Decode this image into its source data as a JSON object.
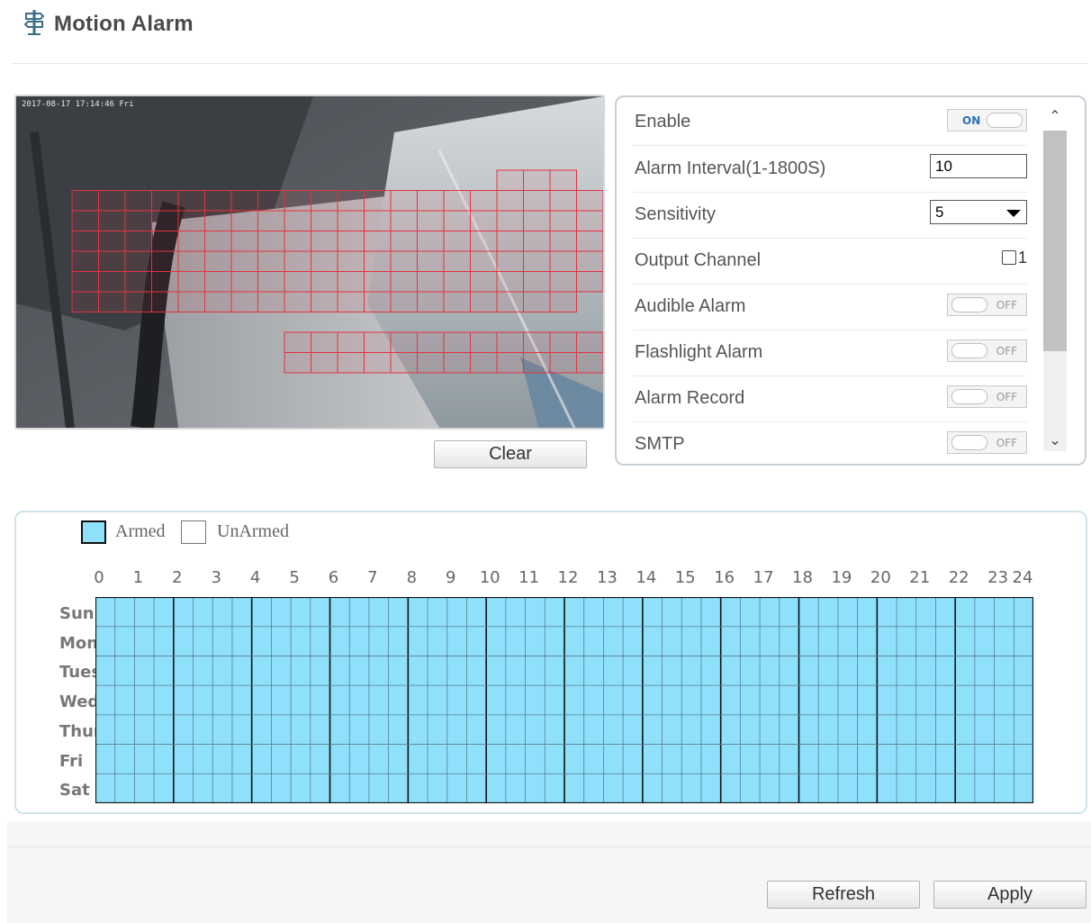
{
  "header": {
    "title": "Motion Alarm",
    "icon": "signpost-icon"
  },
  "video": {
    "timestamp": "2017-08-17 17:14:46 Fri"
  },
  "clear_label": "Clear",
  "settings": {
    "enable": {
      "label": "Enable",
      "state": "ON"
    },
    "alarm_interval": {
      "label": "Alarm Interval(1-1800S)",
      "value": "10"
    },
    "sensitivity": {
      "label": "Sensitivity",
      "value": "5"
    },
    "output_channel": {
      "label": "Output Channel",
      "option": "1",
      "checked": false
    },
    "audible_alarm": {
      "label": "Audible Alarm",
      "state": "OFF"
    },
    "flashlight_alarm": {
      "label": "Flashlight Alarm",
      "state": "OFF"
    },
    "alarm_record": {
      "label": "Alarm Record",
      "state": "OFF"
    },
    "smtp": {
      "label": "SMTP",
      "state": "OFF"
    }
  },
  "schedule": {
    "legend_armed": "Armed",
    "legend_unarmed": "UnArmed",
    "hours": [
      "0",
      "1",
      "2",
      "3",
      "4",
      "5",
      "6",
      "7",
      "8",
      "9",
      "10",
      "11",
      "12",
      "13",
      "14",
      "15",
      "16",
      "17",
      "18",
      "19",
      "20",
      "21",
      "22",
      "23",
      "24"
    ],
    "days": [
      "Sun",
      "Mon",
      "Tues",
      "Wed",
      "Thur",
      "Fri",
      "Sat"
    ],
    "armed_color": "#8ee0fb",
    "all_armed": true
  },
  "footer": {
    "refresh_label": "Refresh",
    "apply_label": "Apply"
  }
}
